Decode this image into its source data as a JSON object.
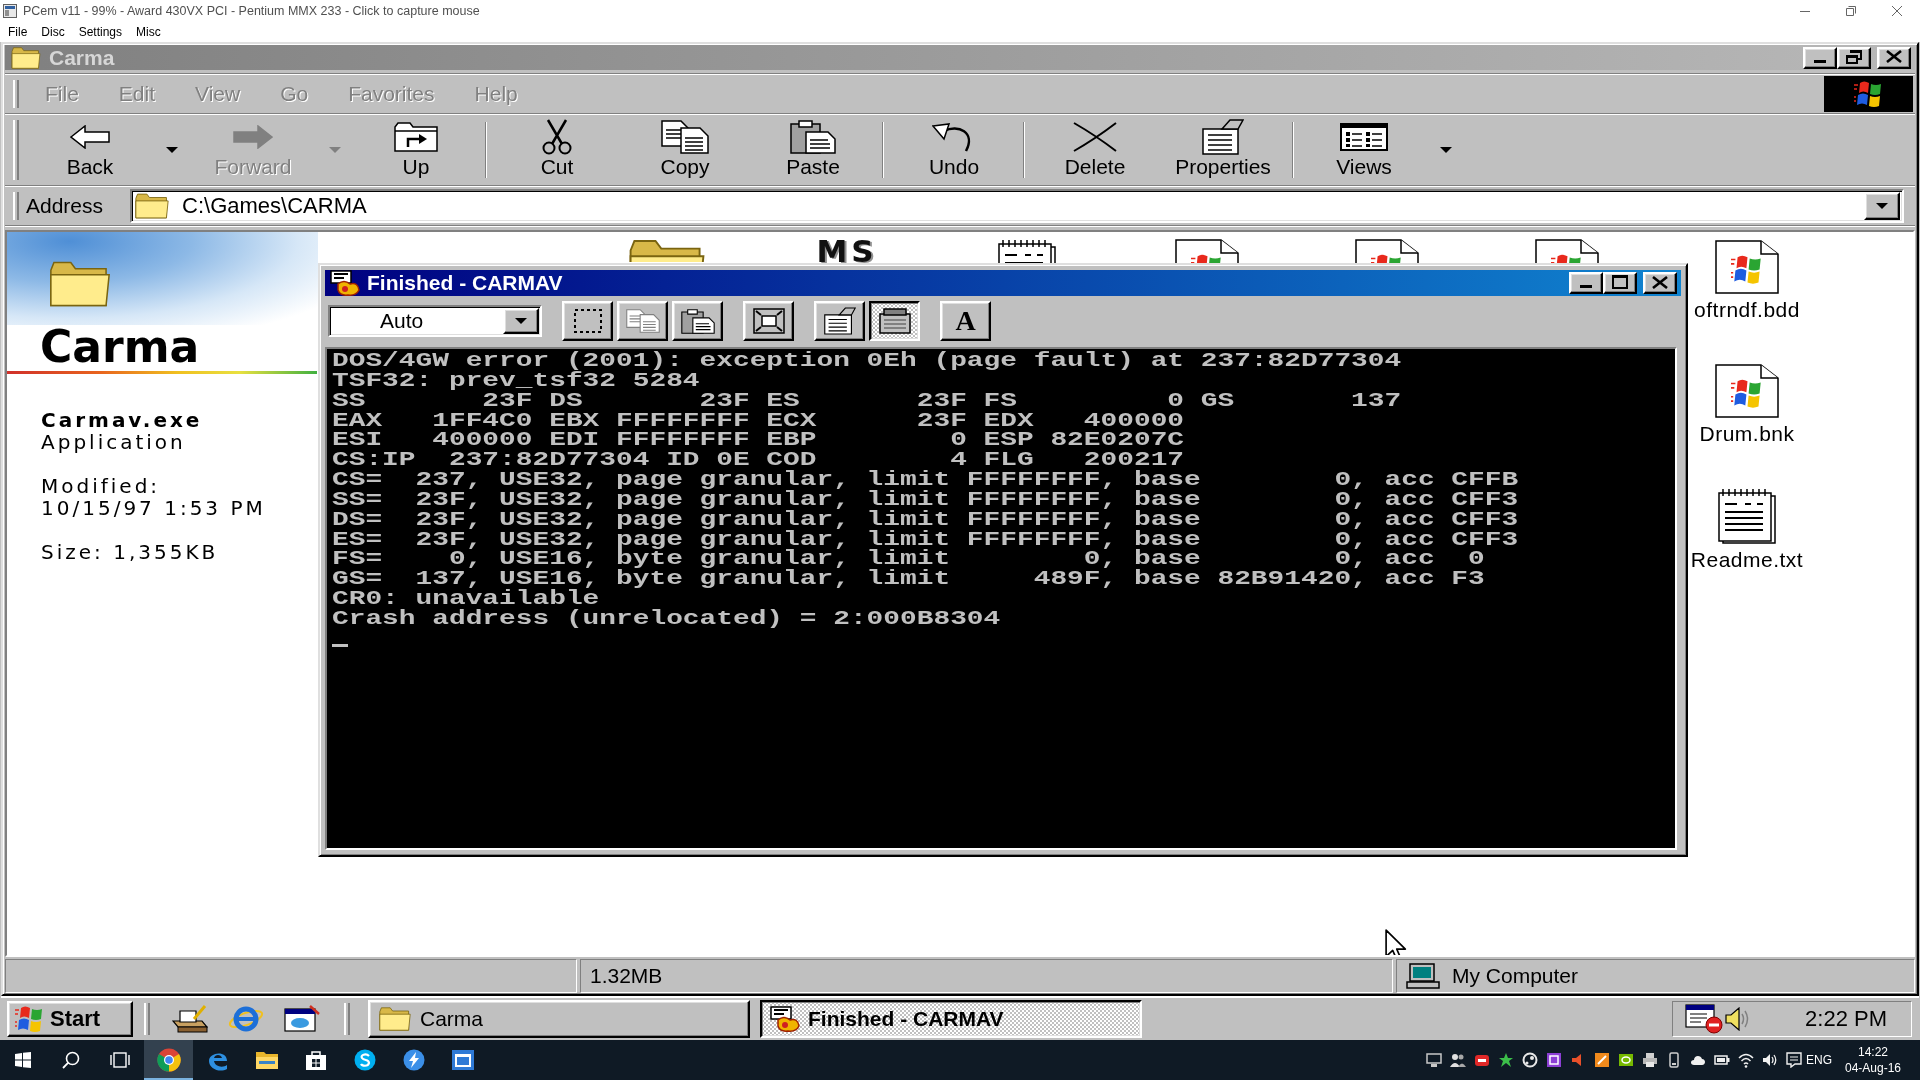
{
  "host_window": {
    "title": "PCem v11 - 99% - Award 430VX PCI - Pentium MMX 233 - Click to capture mouse",
    "menu": [
      "File",
      "Disc",
      "Settings",
      "Misc"
    ]
  },
  "explorer": {
    "title": "Carma",
    "active": false,
    "menu": [
      {
        "label": "File",
        "disabled": true
      },
      {
        "label": "Edit",
        "disabled": true
      },
      {
        "label": "View",
        "disabled": true
      },
      {
        "label": "Go",
        "disabled": true
      },
      {
        "label": "Favorites",
        "disabled": true
      },
      {
        "label": "Help",
        "disabled": true
      }
    ],
    "toolbar": [
      [
        {
          "label": "Back",
          "disabled": false,
          "dropdown": true
        },
        {
          "label": "Forward",
          "disabled": true,
          "dropdown": true
        },
        {
          "label": "Up",
          "disabled": false,
          "dropdown": false
        }
      ],
      [
        {
          "label": "Cut",
          "disabled": false,
          "dropdown": false
        },
        {
          "label": "Copy",
          "disabled": false,
          "dropdown": false
        },
        {
          "label": "Paste",
          "disabled": false,
          "dropdown": false
        }
      ],
      [
        {
          "label": "Undo",
          "disabled": false,
          "dropdown": false
        }
      ],
      [
        {
          "label": "Delete",
          "disabled": false,
          "dropdown": false
        },
        {
          "label": "Properties",
          "disabled": false,
          "dropdown": false
        }
      ],
      [
        {
          "label": "Views",
          "disabled": false,
          "dropdown": true
        }
      ]
    ],
    "address": {
      "label": "Address",
      "value": "C:\\Games\\CARMA"
    },
    "info_panel": {
      "title": "Carma",
      "file_name": "Carmav.exe",
      "file_type": "Application",
      "modified_label": "Modified:",
      "modified": "10/15/97 1:53 PM",
      "size": "Size: 1,355KB"
    },
    "covered_icon_text": "MS",
    "files": [
      {
        "name": "oftrndf.bdd"
      },
      {
        "name": "Drum.bnk"
      },
      {
        "name": "Readme.txt"
      }
    ],
    "status_bar": {
      "size": "1.32MB",
      "location": "My Computer"
    }
  },
  "dos_window": {
    "title": "Finished - CARMAV",
    "active": true,
    "toolbar": {
      "font_size": "Auto",
      "buttons": [
        [
          {
            "pressed": false,
            "disabled": false
          },
          {
            "pressed": false,
            "disabled": true
          },
          {
            "pressed": false,
            "disabled": false
          }
        ],
        [
          {
            "pressed": false,
            "disabled": false
          }
        ],
        [
          {
            "pressed": false,
            "disabled": false
          },
          {
            "pressed": true,
            "disabled": false
          }
        ]
      ],
      "font_button": "A"
    },
    "lines": [
      "DOS/4GW error (2001): exception 0Eh (page fault) at 237:82D77304",
      "TSF32: prev_tsf32 5284",
      "SS       23F DS       23F ES       23F FS         0 GS       137",
      "EAX   1FF4C0 EBX FFFFFFFF ECX      23F EDX   400000",
      "ESI   400000 EDI FFFFFFFF EBP        0 ESP 82E0207C",
      "CS:IP  237:82D77304 ID 0E COD        4 FLG   200217",
      "CS=  237, USE32, page granular, limit FFFFFFFF, base        0, acc CFFB",
      "SS=  23F, USE32, page granular, limit FFFFFFFF, base        0, acc CFF3",
      "DS=  23F, USE32, page granular, limit FFFFFFFF, base        0, acc CFF3",
      "ES=  23F, USE32, page granular, limit FFFFFFFF, base        0, acc CFF3",
      "FS=    0, USE16, byte granular, limit        0, base        0, acc  0",
      "GS=  137, USE16, byte granular, limit     489F, base 82B91420, acc F3",
      "CR0: unavailable",
      "Crash address (unrelocated) = 2:000B8304"
    ]
  },
  "taskbar": {
    "start": "Start",
    "tasks": [
      {
        "label": "Carma",
        "selected": false
      },
      {
        "label": "Finished - CARMAV",
        "selected": true
      }
    ],
    "clock": "2:22 PM"
  },
  "host_taskbar": {
    "apps": [
      {
        "selected": true
      },
      {
        "selected": false
      },
      {
        "selected": false
      },
      {
        "selected": false
      },
      {
        "selected": false
      },
      {
        "selected": false
      },
      {
        "selected": false
      }
    ],
    "language": "ENG",
    "time": "14:22",
    "date": "04-Aug-16"
  }
}
